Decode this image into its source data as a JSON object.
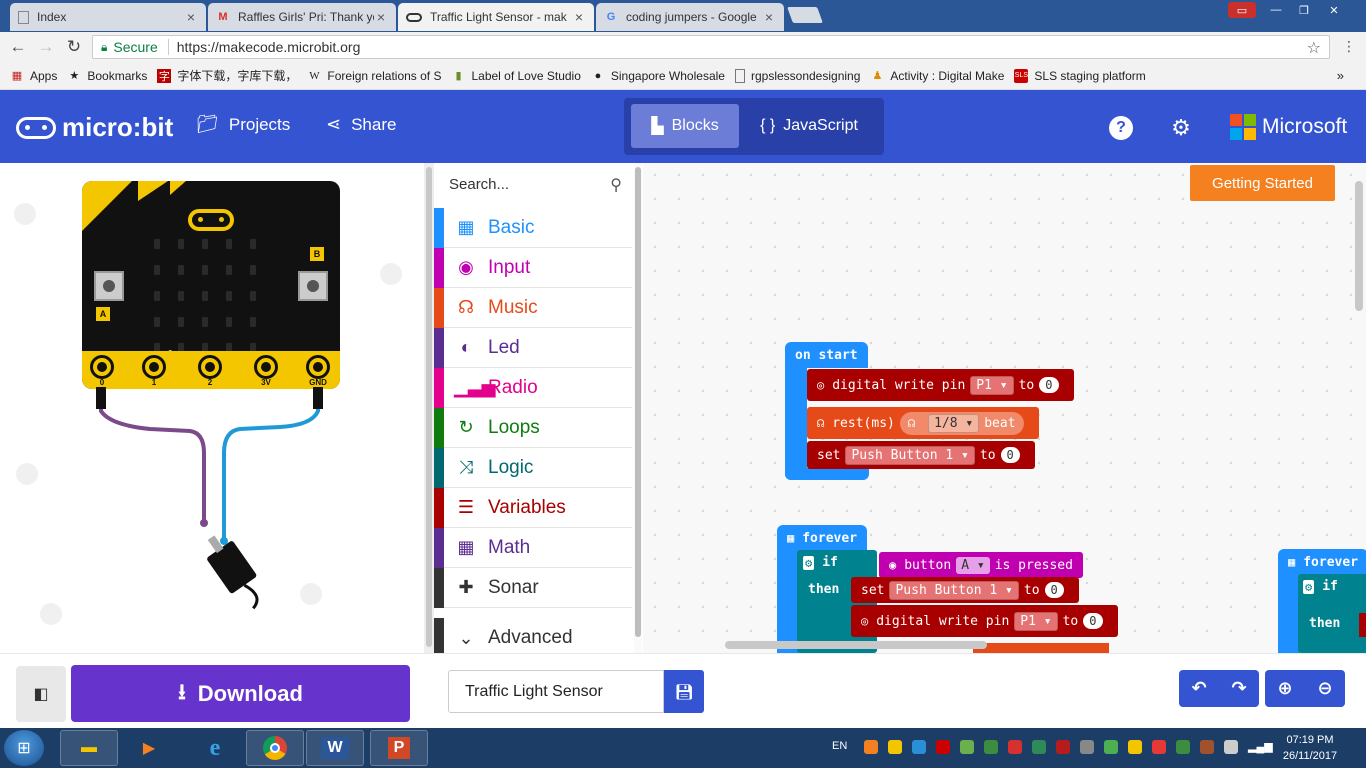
{
  "browser": {
    "tabs": [
      {
        "title": "Index",
        "favicon": "document-icon",
        "active": false
      },
      {
        "title": "Raffles Girls' Pri: Thank yo",
        "favicon": "gmail-icon",
        "active": false
      },
      {
        "title": "Traffic Light Sensor - mak",
        "favicon": "microbit-icon",
        "active": true
      },
      {
        "title": "coding jumpers - Google",
        "favicon": "google-icon",
        "active": false
      }
    ],
    "secure_label": "Secure",
    "url": "https://makecode.microbit.org",
    "bookmarks": [
      {
        "label": "Apps",
        "icon": "apps-grid-icon"
      },
      {
        "label": "Bookmarks",
        "icon": "star-icon"
      },
      {
        "label": "字体下载，字库下载，",
        "icon": "fontsite-icon"
      },
      {
        "label": "Foreign relations of S",
        "icon": "wikipedia-icon"
      },
      {
        "label": "Label of Love Studio",
        "icon": "bottle-icon"
      },
      {
        "label": "Singapore Wholesale",
        "icon": "panda-icon"
      },
      {
        "label": "rgpslessondesigning",
        "icon": "page-icon"
      },
      {
        "label": "Activity : Digital Make",
        "icon": "activity-icon"
      },
      {
        "label": "SLS staging platform",
        "icon": "sls-icon"
      }
    ],
    "more": "»"
  },
  "header": {
    "brand": "micro:bit",
    "projects": "Projects",
    "share": "Share",
    "blocks": "Blocks",
    "javascript": "JavaScript",
    "microsoft": "Microsoft",
    "accent": "#3454d1"
  },
  "simulator": {
    "button_a": "A",
    "button_b": "B",
    "pins": [
      "0",
      "1",
      "2",
      "3V",
      "GND"
    ],
    "pin_zero_label": "0"
  },
  "toolbox": {
    "search_placeholder": "Search...",
    "categories": [
      {
        "label": "Basic",
        "color": "#1e90ff",
        "icon": "grid-icon"
      },
      {
        "label": "Input",
        "color": "#c000b0",
        "icon": "target-icon"
      },
      {
        "label": "Music",
        "color": "#e64a19",
        "icon": "headphones-icon"
      },
      {
        "label": "Led",
        "color": "#5c2d91",
        "icon": "toggle-icon"
      },
      {
        "label": "Radio",
        "color": "#e3008c",
        "icon": "signal-icon"
      },
      {
        "label": "Loops",
        "color": "#107c10",
        "icon": "refresh-icon"
      },
      {
        "label": "Logic",
        "color": "#006970",
        "icon": "shuffle-icon"
      },
      {
        "label": "Variables",
        "color": "#a80000",
        "icon": "lines-icon"
      },
      {
        "label": "Math",
        "color": "#5c2d91",
        "icon": "calculator-icon"
      },
      {
        "label": "Sonar",
        "color": "#333333",
        "icon": "puzzle-icon"
      }
    ],
    "advanced": "Advanced"
  },
  "workspace": {
    "getting_started": "Getting Started",
    "on_start": {
      "hat": "on start",
      "line1": {
        "text": "digital write pin",
        "pin": "P1",
        "to": "to",
        "value": "0"
      },
      "line2": {
        "text": "rest(ms)",
        "beat": "1/8",
        "beat_label": "beat"
      },
      "line3": {
        "set": "set",
        "var": "Push Button 1",
        "to": "to",
        "value": "0"
      }
    },
    "forever": {
      "hat": "forever",
      "if": "if",
      "then": "then",
      "cond": {
        "text": "button",
        "btn": "A",
        "suffix": "is pressed"
      },
      "set": {
        "set": "set",
        "var": "Push Button 1",
        "to": "to",
        "value": "0"
      },
      "write": {
        "text": "digital write pin",
        "pin": "P1",
        "to": "to",
        "value": "0"
      }
    },
    "forever2": {
      "hat": "forever",
      "if": "if",
      "then": "then"
    }
  },
  "bottom": {
    "download": "Download",
    "project_name": "Traffic Light Sensor"
  },
  "taskbar": {
    "lang": "EN",
    "time": "07:19 PM",
    "date": "26/11/2017"
  }
}
